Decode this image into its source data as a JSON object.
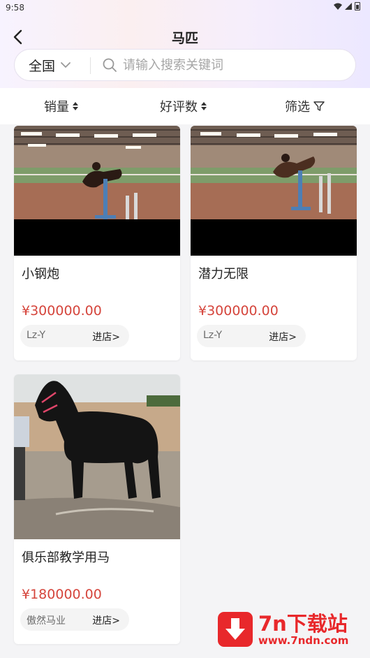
{
  "status_bar": {
    "time": "9:58"
  },
  "header": {
    "title": "马匹"
  },
  "search": {
    "region": "全国",
    "placeholder": "请输入搜索关键词"
  },
  "sort_bar": {
    "sales": "销量",
    "rating": "好评数",
    "filter": "筛选"
  },
  "products": [
    {
      "name": "小钢炮",
      "price": "¥300000.00",
      "shop": "Lz-Y",
      "shop_link": "进店>"
    },
    {
      "name": "潜力无限",
      "price": "¥300000.00",
      "shop": "Lz-Y",
      "shop_link": "进店>"
    },
    {
      "name": "俱乐部教学用马",
      "price": "¥180000.00",
      "shop": "傲然马业",
      "shop_link": "进店>"
    }
  ],
  "watermark": {
    "brand": "7n下载站",
    "url": "www.7ndn.com"
  },
  "colors": {
    "price": "#d5453c",
    "watermark": "#e8282b"
  }
}
